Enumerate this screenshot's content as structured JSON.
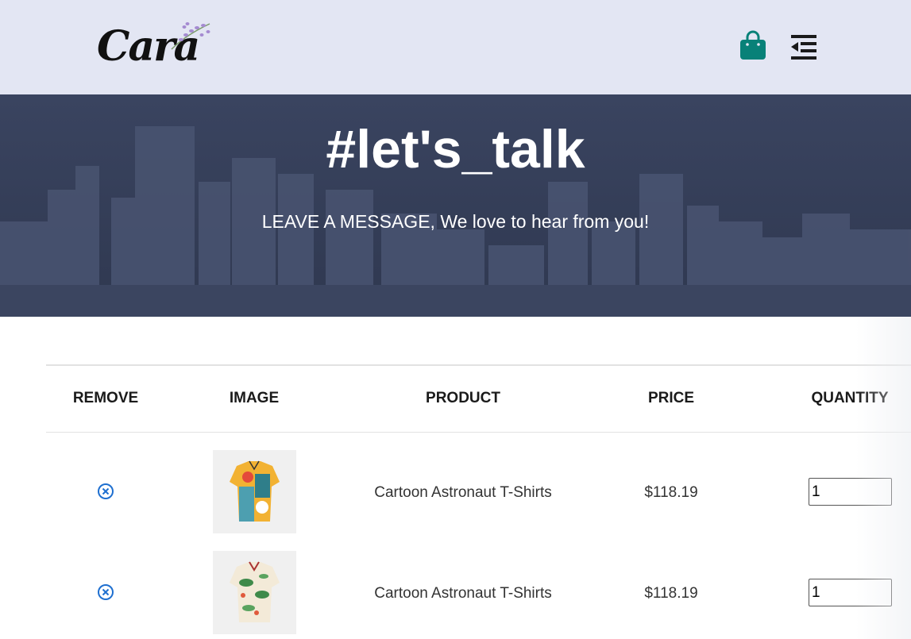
{
  "header": {
    "logo_text": "Cara",
    "icons": {
      "bag": "shopping-bag-icon",
      "menu": "menu-collapse-icon"
    },
    "colors": {
      "background": "#e3e6f3",
      "accent": "#088178"
    }
  },
  "hero": {
    "title": "#let's_talk",
    "subtitle": "LEAVE A MESSAGE, We love to hear from you!"
  },
  "cart": {
    "columns": [
      "REMOVE",
      "IMAGE",
      "PRODUCT",
      "PRICE",
      "QUANTITY"
    ],
    "rows": [
      {
        "product": "Cartoon Astronaut T-Shirts",
        "price": "$118.19",
        "quantity": "1",
        "image": "colorful-shirt"
      },
      {
        "product": "Cartoon Astronaut T-Shirts",
        "price": "$118.19",
        "quantity": "1",
        "image": "floral-shirt"
      }
    ],
    "remove_icon": "circle-x-icon",
    "remove_color": "#1e6fd0"
  }
}
